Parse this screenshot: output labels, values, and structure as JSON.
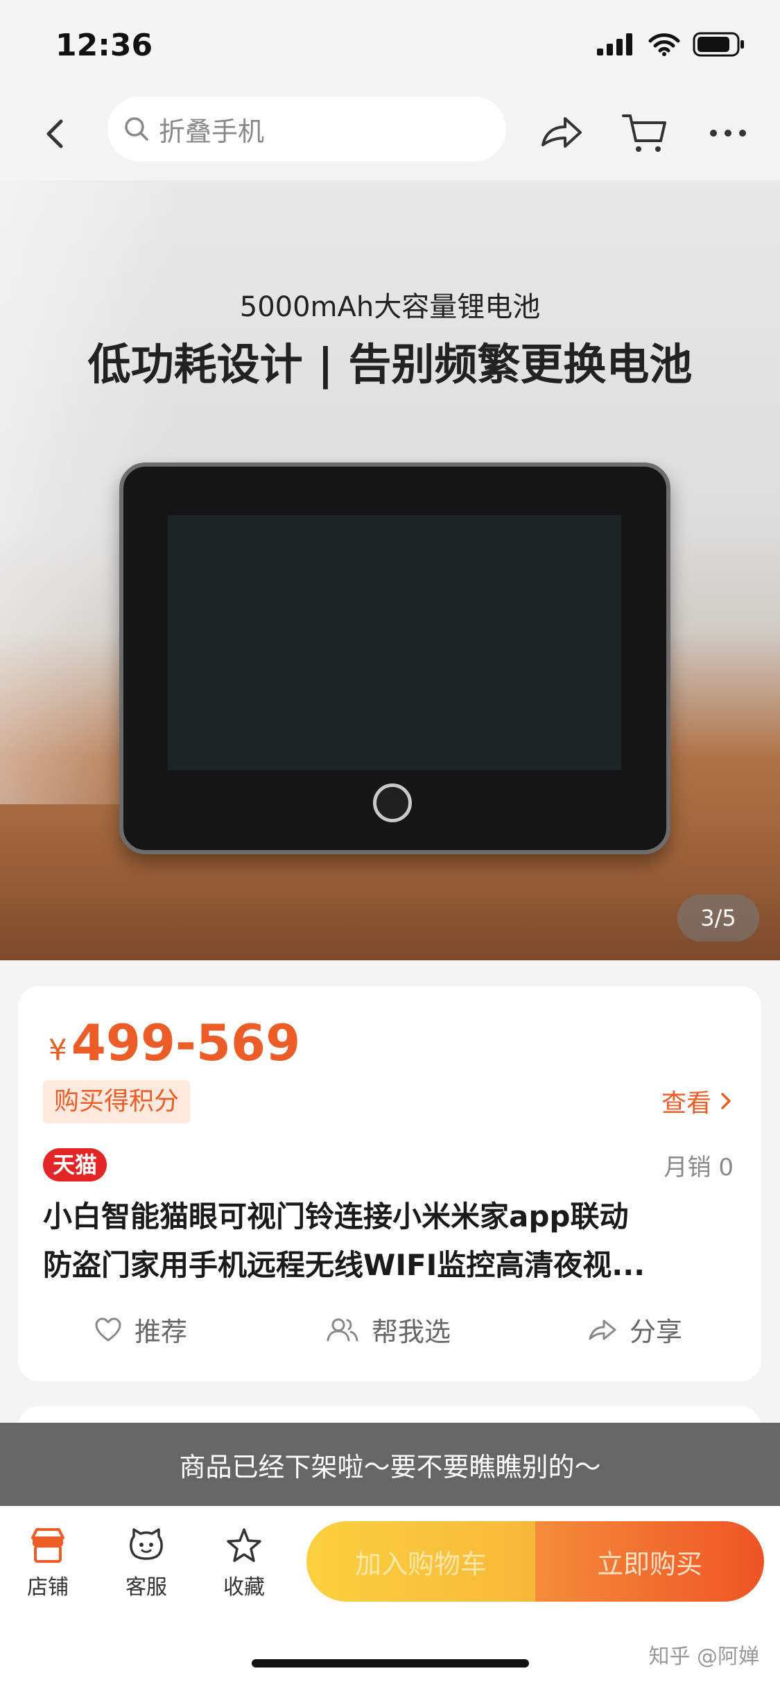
{
  "status_bar": {
    "time": "12:36"
  },
  "nav": {
    "search_placeholder": "折叠手机"
  },
  "hero": {
    "subtitle": "5000mAh大容量锂电池",
    "title": "低功耗设计 | 告别频繁更换电池",
    "counter": "3/5"
  },
  "product": {
    "currency": "¥",
    "price": "499-569",
    "points_tag": "购买得积分",
    "view_label": "查看",
    "store_tag": "天猫",
    "monthly_sales": "月销 0",
    "title_line1": "小白智能猫眼可视门铃连接小米米家app联动",
    "title_line2": "防盗门家用手机远程无线WIFI监控高清夜视...",
    "actions": {
      "recommend": "推荐",
      "help_choose": "帮我选",
      "share": "分享"
    }
  },
  "toast": {
    "text": "商品已经下架啦～要不要瞧瞧别的～"
  },
  "bottom_bar": {
    "store": "店铺",
    "service": "客服",
    "favorite": "收藏",
    "add_to_cart": "加入购物车",
    "buy_now": "立即购买"
  },
  "watermark": "知乎 @阿婵",
  "colors": {
    "accent": "#ec5c27",
    "tmall_red": "#e42526",
    "cart_yellow": "#fbd13f",
    "buy_orange": "#ee5424"
  }
}
